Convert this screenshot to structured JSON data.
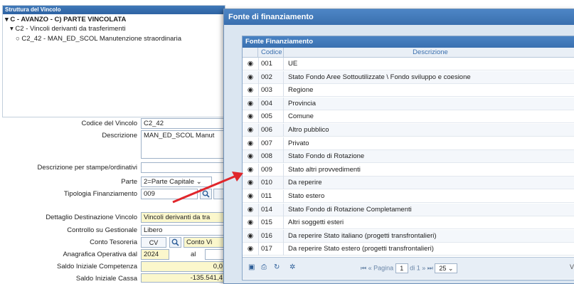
{
  "tree": {
    "header": "Struttura del Vincolo",
    "level1": "C - AVANZO - C) PARTE VINCOLATA",
    "level2": "C2 - Vincoli derivanti da trasferimenti",
    "level3": "C2_42 - MAN_ED_SCOL Manutenzione straordinaria"
  },
  "form": {
    "codice_label": "Codice del Vincolo",
    "codice_value": "C2_42",
    "descrizione_label": "Descrizione",
    "descrizione_value": "MAN_ED_SCOL Manut",
    "desc_stampe_label": "Descrizione per stampe/ordinativi",
    "parte_label": "Parte",
    "parte_value": "2=Parte Capitale",
    "tipologia_label": "Tipologia Finanziamento",
    "tipologia_value": "009",
    "dettaglio_label": "Dettaglio Destinazione Vincolo",
    "dettaglio_value": "Vincoli derivanti da tra",
    "controllo_label": "Controllo su Gestionale",
    "controllo_value": "Libero",
    "tesoreria_label": "Conto Tesoreria",
    "tesoreria_code": "CV",
    "tesoreria_value": "Conto Vi",
    "anagrafica_label": "Anagrafica Operativa dal",
    "anagrafica_from": "2024",
    "anagrafica_al_label": "al",
    "saldo_comp_label": "Saldo Iniziale Competenza",
    "saldo_comp_value": "0,0",
    "saldo_cassa_label": "Saldo Iniziale Cassa",
    "saldo_cassa_value": "-135.541,4"
  },
  "modal": {
    "title": "Fonte di finanziamento",
    "grid_title": "Fonte Finanziamento",
    "col_codice": "Codice",
    "col_descrizione": "Descrizione",
    "rows": [
      {
        "code": "001",
        "desc": "UE"
      },
      {
        "code": "002",
        "desc": "Stato Fondo Aree Sottoutilizzate \\  Fondo sviluppo e coesione"
      },
      {
        "code": "003",
        "desc": "Regione"
      },
      {
        "code": "004",
        "desc": "Provincia"
      },
      {
        "code": "005",
        "desc": "Comune"
      },
      {
        "code": "006",
        "desc": "Altro pubblico"
      },
      {
        "code": "007",
        "desc": "Privato"
      },
      {
        "code": "008",
        "desc": "Stato Fondo di Rotazione"
      },
      {
        "code": "009",
        "desc": "Stato altri provvedimenti"
      },
      {
        "code": "010",
        "desc": "Da reperire"
      },
      {
        "code": "011",
        "desc": "Stato estero"
      },
      {
        "code": "014",
        "desc": "Stato Fondo di Rotazione Completamenti"
      },
      {
        "code": "015",
        "desc": "Altri soggetti esteri"
      },
      {
        "code": "016",
        "desc": "Da reperire Stato italiano (progetti transfrontalieri)"
      },
      {
        "code": "017",
        "desc": "Da reperire Stato estero (progetti transfrontalieri)"
      }
    ],
    "pager": {
      "page_label": "Pagina",
      "page_value": "1",
      "of_label": "di 1",
      "page_size": "25",
      "right_text": "V"
    }
  },
  "colors": {
    "header": "#3a70b0",
    "arrow": "#e0262b",
    "yellow": "#fbf7cc"
  }
}
